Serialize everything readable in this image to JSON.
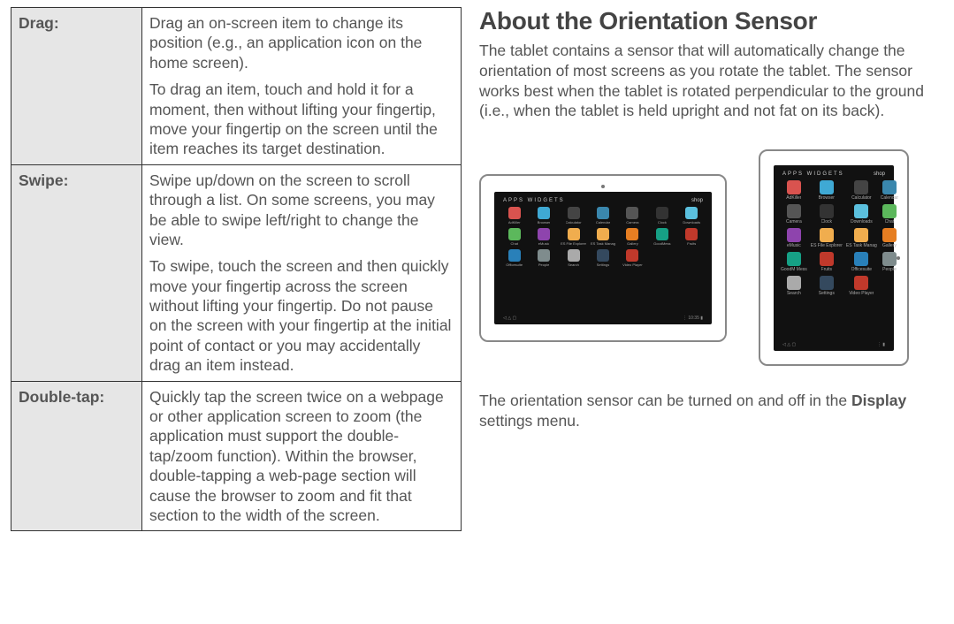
{
  "table": {
    "rows": [
      {
        "term": "Drag:",
        "desc": [
          "Drag an on-screen item to change its position (e.g., an application icon on the home screen).",
          "To drag an item, touch and hold it for a moment, then without lifting your fingertip, move your fingertip on the screen until the item reaches its target destination."
        ]
      },
      {
        "term": "Swipe:",
        "desc": [
          "Swipe up/down on the screen to scroll through a list. On some screens, you may be able to swipe left/right to change the view.",
          "To swipe, touch the screen and then quickly move your fingertip across the screen without lifting your fingertip. Do not pause on the screen with your fingertip at the initial point of contact or you may accidentally drag an item instead."
        ]
      },
      {
        "term": "Double-tap:",
        "desc": [
          "Quickly tap the screen twice on a webpage or other application screen to zoom (the application must support the double-tap/zoom function). Within the browser, double-tapping a web-page section will cause the browser to zoom and fit that section to the width of the screen."
        ]
      }
    ]
  },
  "right": {
    "title": "About the Orientation Sensor",
    "intro": "The tablet contains a sensor that will automatically change the orientation of most screens as you rotate the tablet. The sensor works best when the tablet is rotated perpendicular to the ground (i.e., when the tablet is held upright and not fat on its back).",
    "outro_pre": "The orientation sensor can be turned on and off in the ",
    "outro_bold": "Display",
    "outro_post": " settings menu."
  },
  "screen": {
    "top_left": "APPS    WIDGETS",
    "top_right": "shop",
    "apps_h": [
      {
        "lbl": "AdKiller",
        "c": "#d9534f"
      },
      {
        "lbl": "Browser",
        "c": "#3fa9d4"
      },
      {
        "lbl": "Calculator",
        "c": "#444"
      },
      {
        "lbl": "Calendar",
        "c": "#3a87ad"
      },
      {
        "lbl": "Camera",
        "c": "#555"
      },
      {
        "lbl": "Clock",
        "c": "#333"
      },
      {
        "lbl": "Downloads",
        "c": "#5bc0de"
      },
      {
        "lbl": "Chat",
        "c": "#5cb85c"
      },
      {
        "lbl": "eMusic",
        "c": "#8e44ad"
      },
      {
        "lbl": "ES File Explorer",
        "c": "#f0ad4e"
      },
      {
        "lbl": "ES Task Manag",
        "c": "#f0ad4e"
      },
      {
        "lbl": "Gallery",
        "c": "#e67e22"
      },
      {
        "lbl": "GoodMess",
        "c": "#16a085"
      },
      {
        "lbl": "Fruits",
        "c": "#c0392b"
      },
      {
        "lbl": "Officesuite",
        "c": "#2980b9"
      },
      {
        "lbl": "People",
        "c": "#7f8c8d"
      },
      {
        "lbl": "Search",
        "c": "#aaa"
      },
      {
        "lbl": "Settings",
        "c": "#34495e"
      },
      {
        "lbl": "Video Player",
        "c": "#c0392b"
      }
    ],
    "apps_v": [
      {
        "lbl": "AdKiller",
        "c": "#d9534f"
      },
      {
        "lbl": "Browser",
        "c": "#3fa9d4"
      },
      {
        "lbl": "Calculator",
        "c": "#444"
      },
      {
        "lbl": "Calendar",
        "c": "#3a87ad"
      },
      {
        "lbl": "Camera",
        "c": "#555"
      },
      {
        "lbl": "Clock",
        "c": "#333"
      },
      {
        "lbl": "Downloads",
        "c": "#5bc0de"
      },
      {
        "lbl": "Chat",
        "c": "#5cb85c"
      },
      {
        "lbl": "eMusic",
        "c": "#8e44ad"
      },
      {
        "lbl": "ES File Explorer",
        "c": "#f0ad4e"
      },
      {
        "lbl": "ES Task Manag",
        "c": "#f0ad4e"
      },
      {
        "lbl": "Gallery",
        "c": "#e67e22"
      },
      {
        "lbl": "GoodM Mess",
        "c": "#16a085"
      },
      {
        "lbl": "Fruits",
        "c": "#c0392b"
      },
      {
        "lbl": "Officesuite",
        "c": "#2980b9"
      },
      {
        "lbl": "People",
        "c": "#7f8c8d"
      },
      {
        "lbl": "Search",
        "c": "#aaa"
      },
      {
        "lbl": "Settings",
        "c": "#34495e"
      },
      {
        "lbl": "Video Player",
        "c": "#c0392b"
      }
    ]
  }
}
